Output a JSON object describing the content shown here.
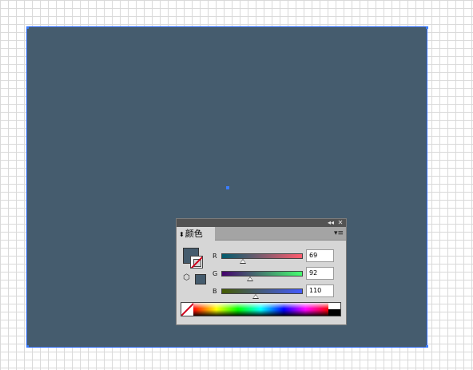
{
  "panel": {
    "collapse_glyph": "◂◂",
    "close_glyph": "✕",
    "tab_arrow": "⬍",
    "tab_label": "颜色",
    "menu_glyph": "▾≡",
    "cube_glyph": "⬡"
  },
  "channels": [
    {
      "label": "R",
      "value": "69",
      "gradient": "linear-gradient(to right, #005c6e, #ff5c6e)",
      "fraction": 0.27
    },
    {
      "label": "G",
      "value": "92",
      "gradient": "linear-gradient(to right, #45006e, #45ff6e)",
      "fraction": 0.36
    },
    {
      "label": "B",
      "value": "110",
      "gradient": "linear-gradient(to right, #455c00, #455cff)",
      "fraction": 0.43
    }
  ],
  "colors": {
    "fill": "#455c6e",
    "accent": "#3b7dff"
  }
}
